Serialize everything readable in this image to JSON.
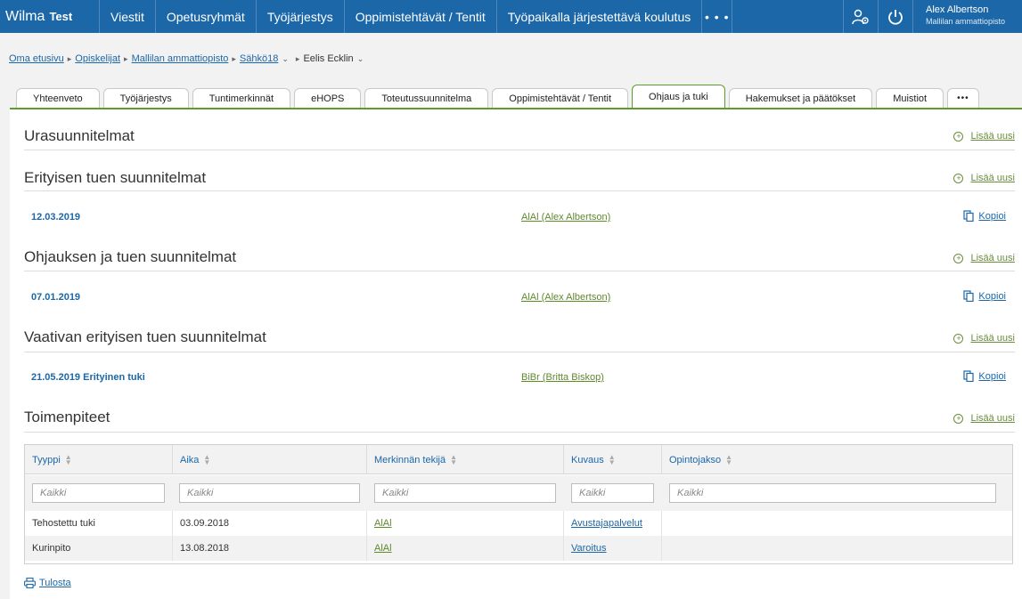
{
  "header": {
    "brand": "Wilma",
    "brand_suffix": "Test",
    "nav": [
      "Viestit",
      "Opetusryhmät",
      "Työjärjestys",
      "Oppimistehtävät / Tentit",
      "Työpaikalla järjestettävä koulutus"
    ],
    "more": "• • •",
    "user_name": "Alex Albertson",
    "user_org": "Mallilan ammattiopisto"
  },
  "breadcrumb": {
    "items": [
      "Oma etusivu",
      "Opiskelijat",
      "Mallilan ammattiopisto",
      "Sähkö18"
    ],
    "current": "Eelis Ecklin"
  },
  "tabs": [
    "Yhteenveto",
    "Työjärjestys",
    "Tuntimerkinnät",
    "eHOPS",
    "Toteutussuunnitelma",
    "Oppimistehtävät / Tentit",
    "Ohjaus ja tuki",
    "Hakemukset ja päätökset",
    "Muistiot"
  ],
  "active_tab": "Ohjaus ja tuki",
  "tabs_more": "•••",
  "add_new_label": "Lisää uusi",
  "copy_label": "Kopioi",
  "sections": {
    "career": {
      "title": "Urasuunnitelmat"
    },
    "special": {
      "title": "Erityisen tuen suunnitelmat",
      "rows": [
        {
          "date": "12.03.2019",
          "author": "AlAl (Alex Albertson)"
        }
      ]
    },
    "guidance": {
      "title": "Ohjauksen ja tuen suunnitelmat",
      "rows": [
        {
          "date": "07.01.2019",
          "author": "AlAl (Alex Albertson)"
        }
      ]
    },
    "demanding": {
      "title": "Vaativan erityisen tuen suunnitelmat",
      "rows": [
        {
          "date": "21.05.2019 Erityinen tuki",
          "author": "BiBr (Britta Biskop)"
        }
      ]
    },
    "measures": {
      "title": "Toimenpiteet"
    }
  },
  "table": {
    "columns": [
      "Tyyppi",
      "Aika",
      "Merkinnän tekijä",
      "Kuvaus",
      "Opintojakso"
    ],
    "filter_placeholder": "Kaikki",
    "rows": [
      {
        "type": "Tehostettu tuki",
        "time": "03.09.2018",
        "author": "AlAl",
        "desc": "Avustajapalvelut",
        "course": ""
      },
      {
        "type": "Kurinpito",
        "time": "13.08.2018",
        "author": "AlAl",
        "desc": "Varoitus",
        "course": ""
      }
    ]
  },
  "print_label": "Tulosta",
  "colors": {
    "primary": "#1b67a8",
    "accent": "#5f9b2a"
  }
}
